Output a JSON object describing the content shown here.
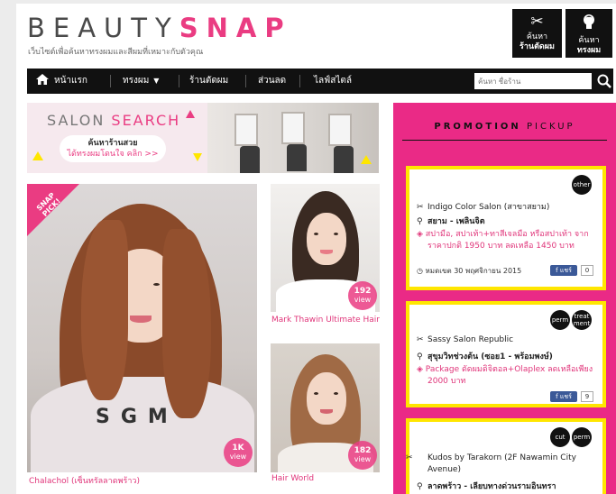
{
  "header": {
    "logo_part1": "BEAUTY",
    "logo_part2": "SNAP",
    "tagline": "เว็บไซต์เพื่อค้นหาทรงผมและสีผมที่เหมาะกับตัวคุณ",
    "find_salon": {
      "line1": "ค้นหา",
      "line2": "ร้านตัดผม",
      "icon": "scissors-icon"
    },
    "find_hairstyle": {
      "line1": "ค้นหา",
      "line2": "ทรงผม",
      "icon": "head-icon"
    }
  },
  "nav": {
    "home": "หน้าแรก",
    "hairstyle": "ทรงผม",
    "salon": "ร้านตัดผม",
    "discount": "ส่วนลด",
    "lifestyle": "ไลฟ์สไตล์",
    "search_placeholder": "ค้นหา ชื่อร้าน"
  },
  "banner": {
    "title_part1": "SALON",
    "title_part2": "SEARCH",
    "pill_line1": "ค้นหาร้านสวย",
    "pill_line2": "ได้ทรงผมโดนใจ คลิก >>"
  },
  "photos": {
    "main": {
      "badge": "SNAP PICK!",
      "views_count": "1K",
      "views_label": "view",
      "caption": "Chalachol (เซ็นทรัลลาดพร้าว)"
    },
    "side1": {
      "views_count": "192",
      "views_label": "view",
      "caption": "Mark Thawin Ultimate Hair"
    },
    "side2": {
      "views_count": "182",
      "views_label": "view",
      "caption": "Hair World"
    }
  },
  "promotion": {
    "title_part1": "PROMOTION",
    "title_part2": "PICKUP",
    "cards": [
      {
        "tags": [
          "other"
        ],
        "salon": "Indigo Color Salon (สาขาสยาม)",
        "location": "สยาม - เพลินจิต",
        "offer": "สปามือ, สปาเท้า+ทาสีเจลมือ หรือสปาเท้า จากราคาปกติ 1950 บาท ลดเหลือ 1450 บาท",
        "expiry": "หมดเขต 30 พฤศจิกายน 2015",
        "share_label": "แชร์",
        "share_count": "0"
      },
      {
        "tags": [
          "perm",
          "treat ment"
        ],
        "salon": "Sassy Salon Republic",
        "location": "สุขุมวิทช่วงต้น (ซอย1 - พร้อมพงษ์)",
        "offer": "Package ดัดผมดิจิตอล+Olaplex ลดเหลือเพียง 2000 บาท",
        "share_label": "แชร์",
        "share_count": "9"
      },
      {
        "tags": [
          "cut",
          "perm"
        ],
        "salon": "Kudos by Tarakorn (2F Nawamin City Avenue)",
        "location": "ลาดพร้าว - เลียบทางด่วนรามอินทรา"
      }
    ]
  },
  "colors": {
    "brand_pink": "#ea3c82",
    "promo_bg": "#ea2a86",
    "card_border": "#ffe600",
    "nav_bg": "#111111"
  }
}
